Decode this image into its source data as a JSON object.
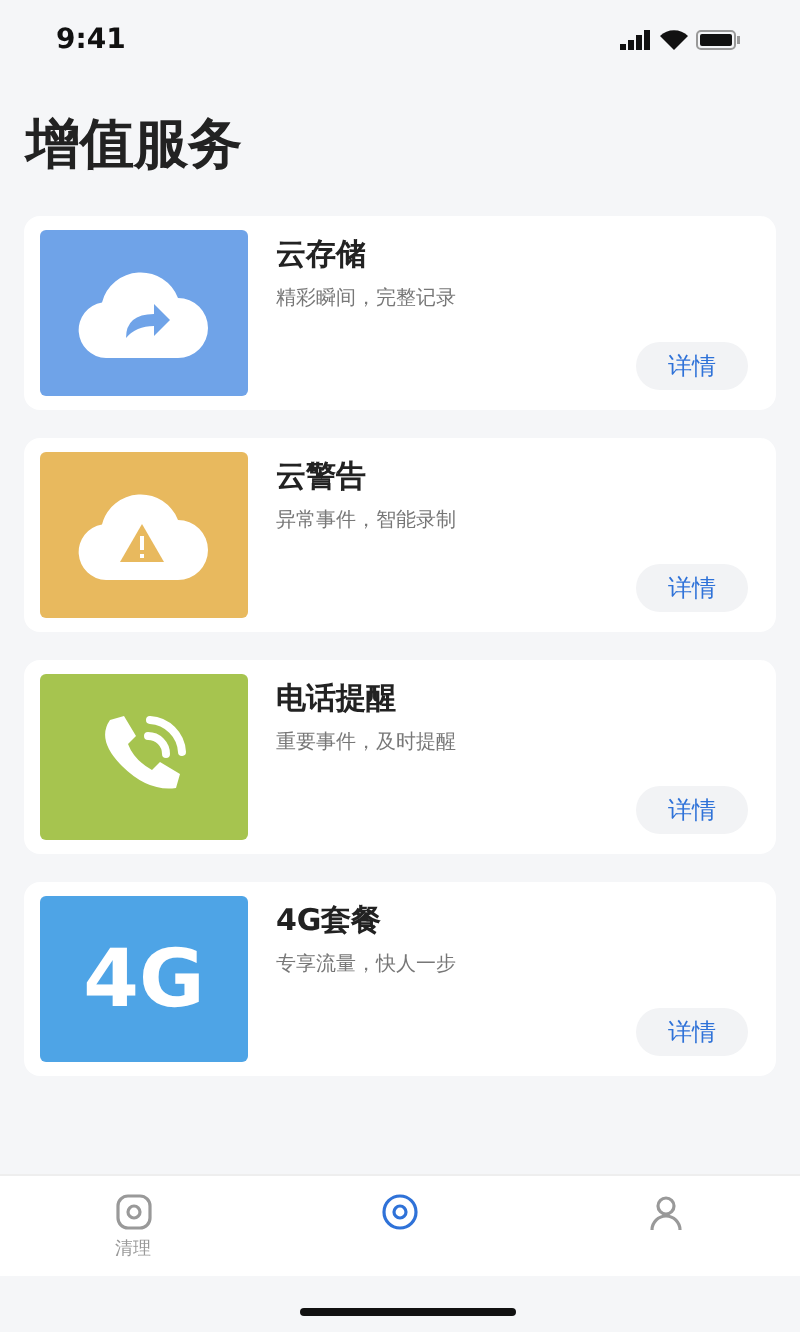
{
  "status_bar": {
    "time": "9:41"
  },
  "title": "增值服务",
  "services": [
    {
      "kind": "cloud-upload",
      "title": "云存储",
      "subtitle": "精彩瞬间，完整记录",
      "button": "详情",
      "color": "#6fa3e8"
    },
    {
      "kind": "cloud-warning",
      "title": "云警告",
      "subtitle": "异常事件，智能录制",
      "button": "详情",
      "color": "#e8b95e"
    },
    {
      "kind": "phone",
      "title": "电话提醒",
      "subtitle": "重要事件，及时提醒",
      "button": "详情",
      "color": "#a6c44f"
    },
    {
      "kind": "text",
      "tile_text": "4G",
      "title": "4G套餐",
      "subtitle": "专享流量，快人一步",
      "button": "详情",
      "color": "#4ea4e6"
    }
  ],
  "tab_bar": [
    {
      "kind": "camera",
      "label": "清理",
      "selected": false
    },
    {
      "kind": "target",
      "selected": true
    },
    {
      "kind": "person",
      "selected": false
    }
  ]
}
